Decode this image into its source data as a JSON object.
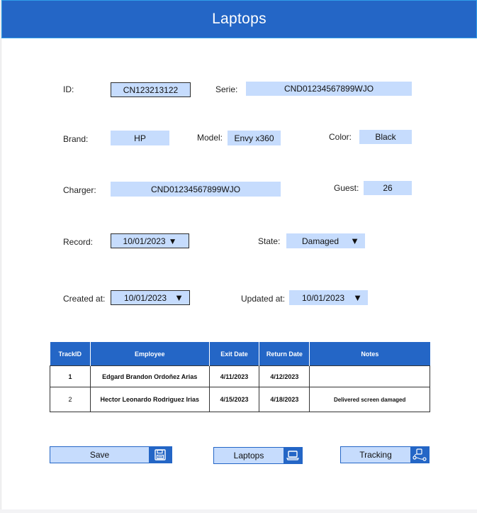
{
  "header": {
    "title": "Laptops"
  },
  "form": {
    "id": {
      "label": "ID:",
      "value": "CN123213122"
    },
    "serie": {
      "label": "Serie:",
      "value": "CND01234567899WJO"
    },
    "brand": {
      "label": "Brand:",
      "value": "HP"
    },
    "model": {
      "label": "Model:",
      "value": "Envy x360"
    },
    "color": {
      "label": "Color:",
      "value": "Black"
    },
    "charger": {
      "label": "Charger:",
      "value": "CND01234567899WJO"
    },
    "guest": {
      "label": "Guest:",
      "value": "26"
    },
    "record": {
      "label": "Record:",
      "value": "10/01/2023"
    },
    "state": {
      "label": "State:",
      "value": "Damaged"
    },
    "created_at": {
      "label": "Created at:",
      "value": "10/01/2023"
    },
    "updated_at": {
      "label": "Updated at:",
      "value": "10/01/2023"
    }
  },
  "table": {
    "headers": [
      "TrackID",
      "Employee",
      "Exit Date",
      "Return Date",
      "Notes"
    ],
    "rows": [
      {
        "track_id": "1",
        "employee": "Edgard Brandon Ordoñez Arias",
        "exit_date": "4/11/2023",
        "return_date": "4/12/2023",
        "notes": ""
      },
      {
        "track_id": "2",
        "employee": "Hector Leonardo Rodriguez Irias",
        "exit_date": "4/15/2023",
        "return_date": "4/18/2023",
        "notes": "Delivered screen damaged"
      }
    ]
  },
  "buttons": {
    "save": {
      "label": "Save",
      "icon": "floppy-disk-icon"
    },
    "laptops": {
      "label": "Laptops",
      "icon": "laptop-icon"
    },
    "tracking": {
      "label": "Tracking",
      "icon": "tracking-route-icon"
    }
  },
  "colors": {
    "primary": "#2466c6",
    "field_bg": "#c6dcfd",
    "header_border": "#2f9de8"
  }
}
